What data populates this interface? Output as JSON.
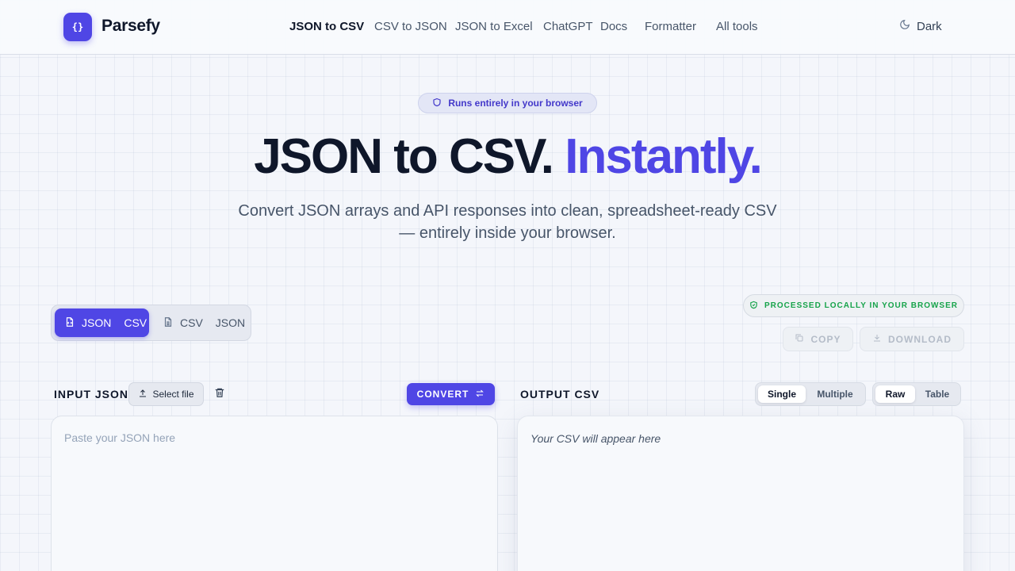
{
  "header": {
    "logo_glyph": "{}",
    "brand": "Parsefy",
    "nav": [
      {
        "label": "JSON to CSV",
        "active": true
      },
      {
        "label": "CSV to JSON",
        "active": false
      },
      {
        "label": "JSON to Excel",
        "active": false
      },
      {
        "label": "ChatGPT",
        "active": false
      },
      {
        "label": "Docs",
        "active": false
      },
      {
        "label": "Formatter",
        "active": false
      },
      {
        "label": "All tools",
        "active": false
      }
    ],
    "theme_label": "Dark",
    "theme_icon": "moon-icon"
  },
  "hero": {
    "pill": "Runs entirely in your browser",
    "pill_icon": "shield-icon",
    "title_main": "JSON to CSV.",
    "title_accent": "Instantly.",
    "subtitle": "Convert JSON arrays and API responses into clean, spreadsheet-ready CSV — entirely inside your browser."
  },
  "modes": {
    "json_csv": {
      "from": "JSON",
      "to": "CSV",
      "active": true
    },
    "csv_json": {
      "from": "CSV",
      "to": "JSON",
      "active": false
    }
  },
  "status": {
    "local_badge": "PROCESSED LOCALLY IN YOUR BROWSER",
    "copy": "COPY",
    "download": "DOWNLOAD"
  },
  "input": {
    "label": "INPUT JSON",
    "select_file": "Select file",
    "convert": "CONVERT",
    "convert_icon": "swap-icon",
    "placeholder": "Paste your JSON here"
  },
  "output": {
    "label": "OUTPUT CSV",
    "mode_options": [
      {
        "label": "Single",
        "active": true
      },
      {
        "label": "Multiple",
        "active": false
      }
    ],
    "view_options": [
      {
        "label": "Raw",
        "active": true
      },
      {
        "label": "Table",
        "active": false
      }
    ],
    "placeholder": "Your CSV will appear here"
  },
  "colors": {
    "accent": "#4f46e5",
    "success": "#16a34a",
    "text": "#0f172a",
    "muted": "#475569"
  }
}
